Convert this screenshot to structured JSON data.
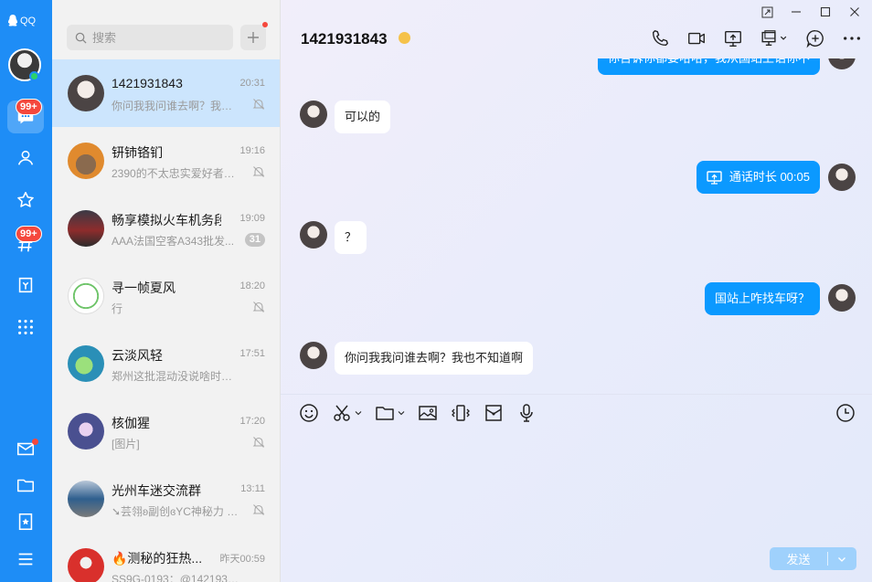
{
  "app": {
    "logo_text": "QQ",
    "accent": "#1e8df6",
    "bubble_out_color": "#0b99ff"
  },
  "nav": {
    "items": [
      {
        "icon": "message-icon",
        "badge": "99+",
        "active": true
      },
      {
        "icon": "contacts-icon"
      },
      {
        "icon": "star-icon"
      },
      {
        "icon": "channel-icon",
        "badge": "99+"
      },
      {
        "icon": "game-icon"
      },
      {
        "icon": "apps-grid-icon"
      },
      {
        "icon": "mail-icon",
        "dot": true
      },
      {
        "icon": "folder-icon"
      },
      {
        "icon": "favorites-icon"
      },
      {
        "icon": "menu-icon"
      }
    ]
  },
  "search": {
    "placeholder": "搜索"
  },
  "conversations": [
    {
      "name": "1421931843",
      "time": "20:31",
      "preview": "你问我我问谁去啊？我也...",
      "muted": true,
      "active": true
    },
    {
      "name": "钘铈铬钔",
      "time": "19:16",
      "preview": "2390的不太忠实爱好者：...",
      "muted": true
    },
    {
      "name": "畅享模拟火车机务段",
      "time": "19:09",
      "preview": "AAA法国空客A343批发...",
      "count": "31"
    },
    {
      "name": "寻一帧夏风",
      "time": "18:20",
      "preview": "行",
      "muted": true
    },
    {
      "name": "云淡风轻",
      "time": "17:51",
      "preview": "郑州这批混动没说啥时候下吧"
    },
    {
      "name": "核伽猩",
      "time": "17:20",
      "preview": "[图片]",
      "muted": true
    },
    {
      "name": "光州车迷交流群",
      "time": "13:11",
      "preview": "➘芸翎ʚ副创ɞYC神秘力 B...",
      "muted": true
    },
    {
      "name": "🔥测秘的狂热...",
      "time": "昨天00:59",
      "preview": "SS9G-0193：@1421931843..."
    }
  ],
  "chat": {
    "title": "1421931843",
    "messages": [
      {
        "dir": "out",
        "text": "你告诉你都要哈哈，我从国站上话你不"
      },
      {
        "dir": "in",
        "text": "可以的"
      },
      {
        "dir": "out",
        "text": "通话时长 00:05",
        "call": true
      },
      {
        "dir": "in",
        "text": "？"
      },
      {
        "dir": "out",
        "text": "国站上咋找车呀？"
      },
      {
        "dir": "in",
        "text": "你问我我问谁去啊？我也不知道啊"
      }
    ]
  },
  "composer": {
    "send_label": "发送"
  }
}
